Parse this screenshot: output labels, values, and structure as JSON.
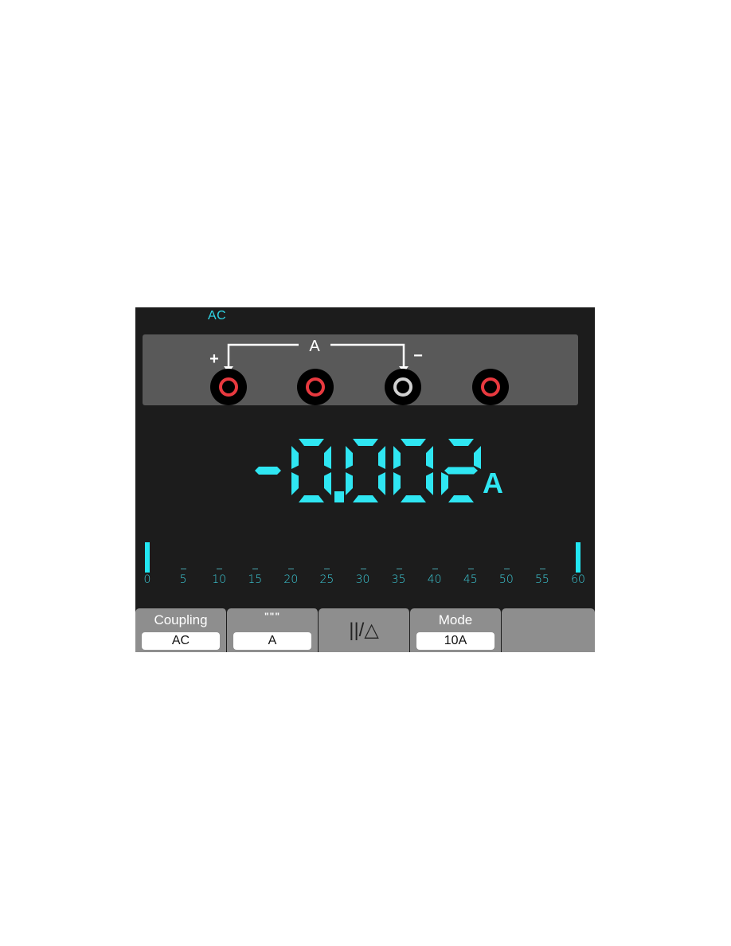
{
  "status": {
    "coupling_indicator": "AC"
  },
  "jack_panel": {
    "connection_label": "A",
    "positive_symbol": "+",
    "negative_symbol": "−",
    "jacks": [
      {
        "name": "jack-1",
        "ring_color": "#e8393f",
        "connected": "positive"
      },
      {
        "name": "jack-2",
        "ring_color": "#e8393f",
        "connected": "none"
      },
      {
        "name": "jack-3",
        "ring_color": "#d0d0d0",
        "connected": "negative"
      },
      {
        "name": "jack-4",
        "ring_color": "#e8393f",
        "connected": "none"
      }
    ]
  },
  "reading": {
    "value": "-0.002",
    "unit": "A",
    "color": "#2fe6f2"
  },
  "bargraph": {
    "min": 0,
    "max": 60,
    "current_fraction": 0,
    "tick_labels": [
      "0",
      "5",
      "10",
      "15",
      "20",
      "25",
      "30",
      "35",
      "40",
      "45",
      "50",
      "55",
      "60"
    ]
  },
  "softkeys": [
    {
      "title": "Coupling",
      "value": "AC"
    },
    {
      "title": "\"\"\"",
      "value": "A"
    },
    {
      "title": "",
      "icon": "||/△",
      "value": ""
    },
    {
      "title": "Mode",
      "value": "10A"
    },
    {
      "title": "",
      "value": ""
    }
  ],
  "colors": {
    "screen_bg": "#1c1c1c",
    "panel_bg": "#595959",
    "accent_cyan": "#2fe6f2",
    "softkey_bg": "#8e8e8e"
  }
}
